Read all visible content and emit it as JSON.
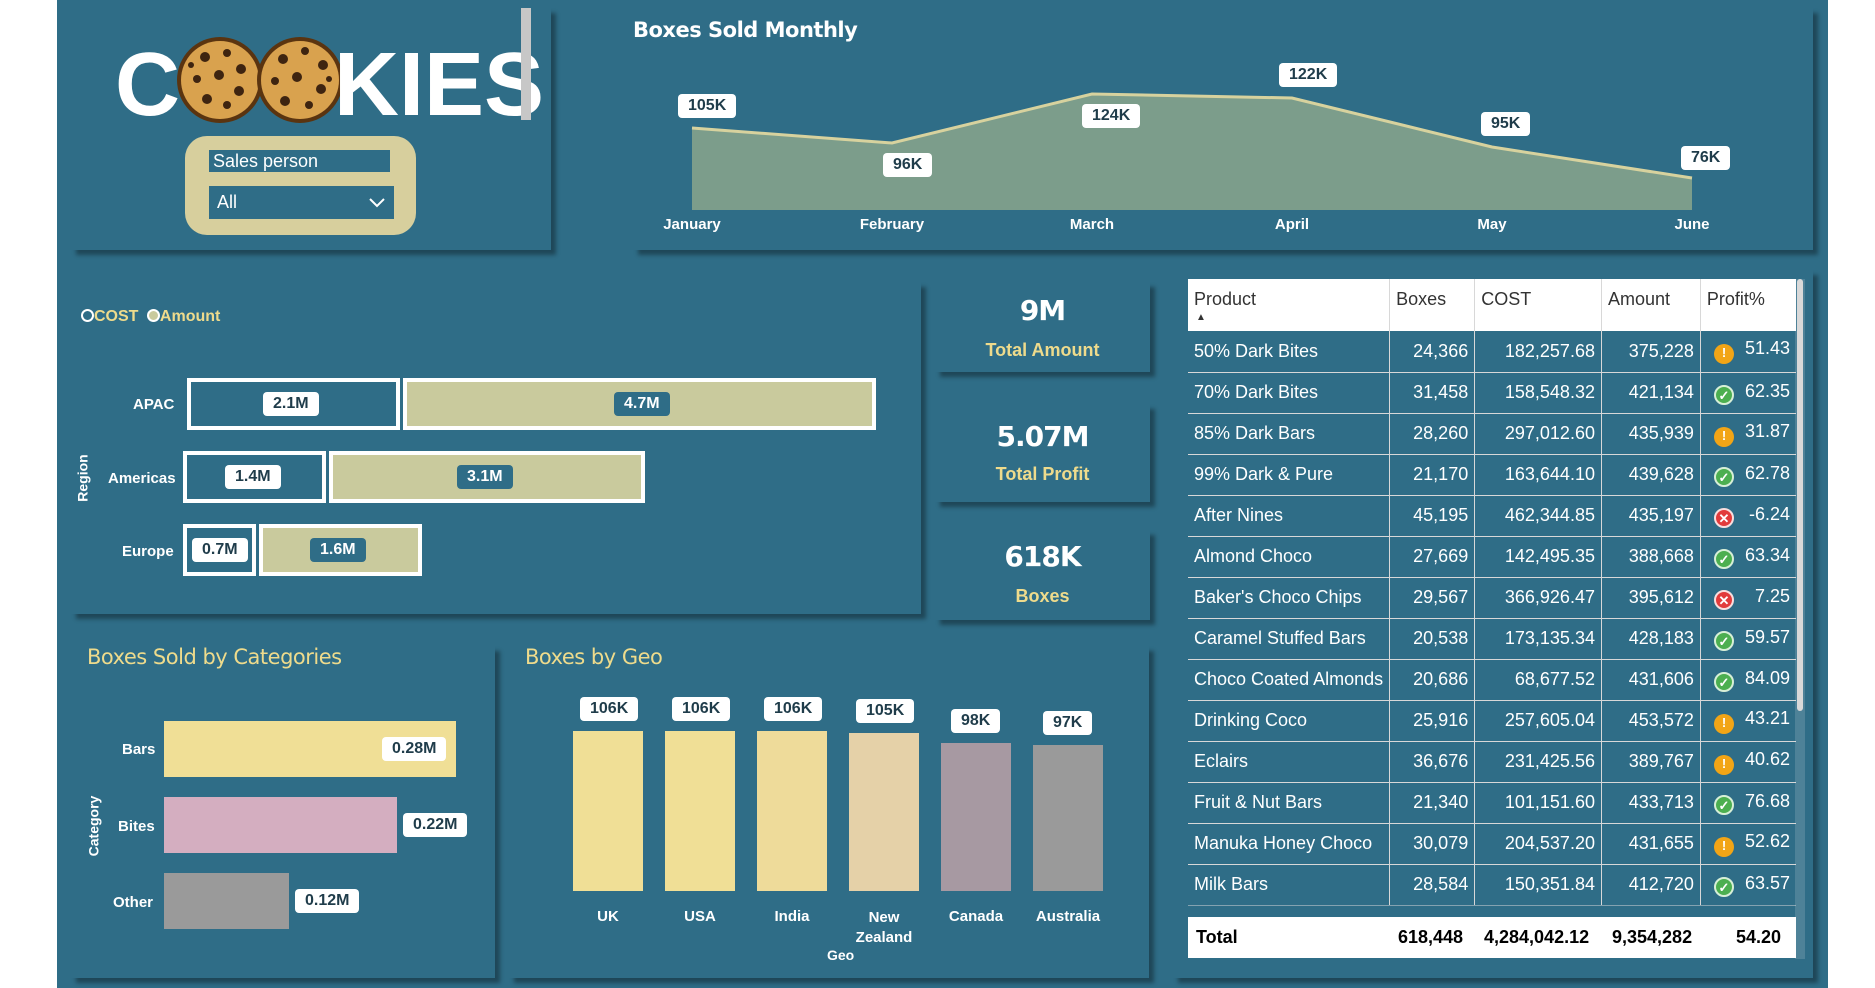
{
  "logo": {
    "text_left": "C",
    "text_right": "KIES"
  },
  "slicer": {
    "title": "Sales person",
    "value": "All"
  },
  "monthly": {
    "title": "Boxes Sold Monthly",
    "labels": [
      "105K",
      "96K",
      "124K",
      "122K",
      "95K",
      "76K"
    ]
  },
  "region": {
    "legend_cost": "COST",
    "legend_amount": "Amount",
    "axis_title": "Region",
    "rows": [
      {
        "name": "APAC",
        "cost_label": "2.1M",
        "amount_label": "4.7M"
      },
      {
        "name": "Americas",
        "cost_label": "1.4M",
        "amount_label": "3.1M"
      },
      {
        "name": "Europe",
        "cost_label": "0.7M",
        "amount_label": "1.6M"
      }
    ]
  },
  "kpis": [
    {
      "value": "9M",
      "label": "Total Amount"
    },
    {
      "value": "5.07M",
      "label": "Total Profit"
    },
    {
      "value": "618K",
      "label": "Boxes"
    }
  ],
  "categories": {
    "title": "Boxes Sold by Categories",
    "axis_title": "Category",
    "rows": [
      {
        "name": "Bars",
        "label": "0.28M"
      },
      {
        "name": "Bites",
        "label": "0.22M"
      },
      {
        "name": "Other",
        "label": "0.12M"
      }
    ]
  },
  "geo": {
    "title": "Boxes by Geo",
    "axis_title": "Geo",
    "countries": [
      {
        "name": "UK",
        "label": "106K"
      },
      {
        "name": "USA",
        "label": "106K"
      },
      {
        "name": "India",
        "label": "106K"
      },
      {
        "name": "New Zealand",
        "label": "105K"
      },
      {
        "name": "Canada",
        "label": "98K"
      },
      {
        "name": "Australia",
        "label": "97K"
      }
    ]
  },
  "chart_data": [
    {
      "type": "area",
      "title": "Boxes Sold Monthly",
      "categories": [
        "January",
        "February",
        "March",
        "April",
        "May",
        "June"
      ],
      "values": [
        105000,
        96000,
        124000,
        122000,
        95000,
        76000
      ]
    },
    {
      "type": "bar",
      "orientation": "horizontal",
      "stacked": true,
      "ylabel": "Region",
      "categories": [
        "APAC",
        "Americas",
        "Europe"
      ],
      "series": [
        {
          "name": "COST",
          "values": [
            2.1,
            1.4,
            0.7
          ]
        },
        {
          "name": "Amount",
          "values": [
            4.7,
            3.1,
            1.6
          ]
        }
      ]
    },
    {
      "type": "bar",
      "orientation": "horizontal",
      "title": "Boxes Sold by Categories",
      "ylabel": "Category",
      "categories": [
        "Bars",
        "Bites",
        "Other"
      ],
      "values": [
        0.28,
        0.22,
        0.12
      ]
    },
    {
      "type": "bar",
      "title": "Boxes by Geo",
      "xlabel": "Geo",
      "categories": [
        "UK",
        "USA",
        "India",
        "New Zealand",
        "Canada",
        "Australia"
      ],
      "values": [
        106,
        106,
        106,
        105,
        98,
        97
      ]
    }
  ],
  "table": {
    "headers": [
      "Product",
      "Boxes",
      "COST",
      "Amount",
      "Profit%"
    ],
    "rows": [
      {
        "product": "50% Dark Bites",
        "boxes": "24,366",
        "cost": "182,257.68",
        "amount": "375,228",
        "status": "warn",
        "profit": "51.43"
      },
      {
        "product": "70% Dark Bites",
        "boxes": "31,458",
        "cost": "158,548.32",
        "amount": "421,134",
        "status": "ok",
        "profit": "62.35"
      },
      {
        "product": "85% Dark Bars",
        "boxes": "28,260",
        "cost": "297,012.60",
        "amount": "435,939",
        "status": "warn",
        "profit": "31.87"
      },
      {
        "product": "99% Dark & Pure",
        "boxes": "21,170",
        "cost": "163,644.10",
        "amount": "439,628",
        "status": "ok",
        "profit": "62.78"
      },
      {
        "product": "After Nines",
        "boxes": "45,195",
        "cost": "462,344.85",
        "amount": "435,197",
        "status": "bad",
        "profit": "-6.24"
      },
      {
        "product": "Almond Choco",
        "boxes": "27,669",
        "cost": "142,495.35",
        "amount": "388,668",
        "status": "ok",
        "profit": "63.34"
      },
      {
        "product": "Baker's Choco Chips",
        "boxes": "29,567",
        "cost": "366,926.47",
        "amount": "395,612",
        "status": "bad",
        "profit": "7.25"
      },
      {
        "product": "Caramel Stuffed Bars",
        "boxes": "20,538",
        "cost": "173,135.34",
        "amount": "428,183",
        "status": "ok",
        "profit": "59.57"
      },
      {
        "product": "Choco Coated Almonds",
        "boxes": "20,686",
        "cost": "68,677.52",
        "amount": "431,606",
        "status": "ok",
        "profit": "84.09"
      },
      {
        "product": "Drinking Coco",
        "boxes": "25,916",
        "cost": "257,605.04",
        "amount": "453,572",
        "status": "warn",
        "profit": "43.21"
      },
      {
        "product": "Eclairs",
        "boxes": "36,676",
        "cost": "231,425.56",
        "amount": "389,767",
        "status": "warn",
        "profit": "40.62"
      },
      {
        "product": "Fruit & Nut Bars",
        "boxes": "21,340",
        "cost": "101,151.60",
        "amount": "433,713",
        "status": "ok",
        "profit": "76.68"
      },
      {
        "product": "Manuka Honey Choco",
        "boxes": "30,079",
        "cost": "204,537.20",
        "amount": "431,655",
        "status": "warn",
        "profit": "52.62"
      },
      {
        "product": "Milk Bars",
        "boxes": "28,584",
        "cost": "150,351.84",
        "amount": "412,720",
        "status": "ok",
        "profit": "63.57"
      }
    ],
    "total": {
      "label": "Total",
      "boxes": "618,448",
      "cost": "4,284,042.12",
      "amount": "9,354,282",
      "profit": "54.20"
    }
  }
}
